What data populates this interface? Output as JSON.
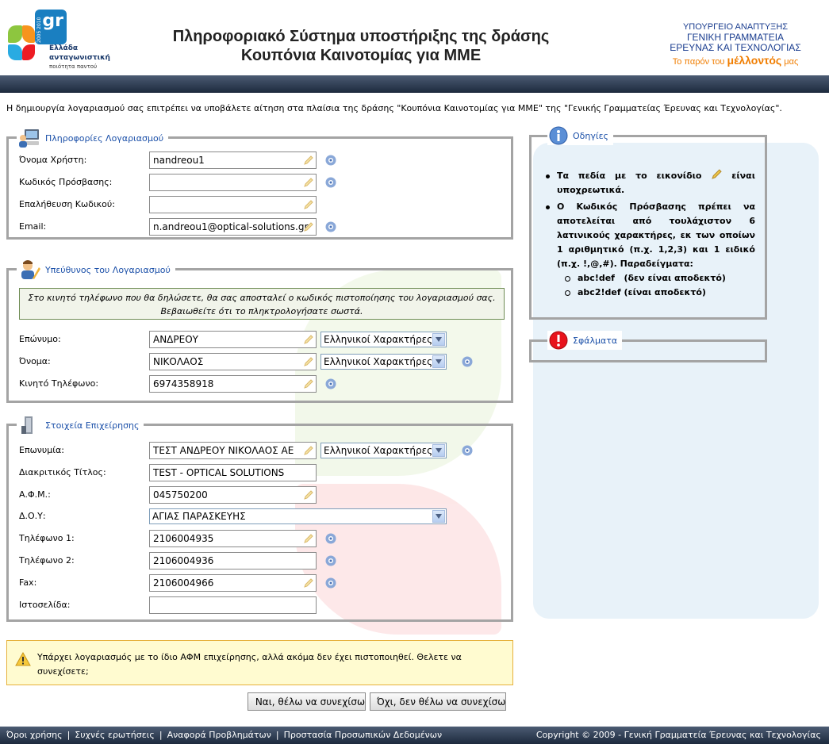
{
  "header": {
    "logo": {
      "gr": "gr",
      "years": "2005 2010",
      "line1": "Ελλάδα",
      "line2": "ανταγωνιστική",
      "line3": "ποιότητα παντού"
    },
    "title_line1": "Πληροφοριακό Σύστημα υποστήριξης της δράσης",
    "title_line2": "Κουπόνια Καινοτομίας για ΜΜΕ",
    "ministry_line1": "ΥΠΟΥΡΓΕΙΟ ΑΝΑΠΤΥΞΗΣ",
    "ministry_line2": "ΓΕΝΙΚΗ ΓΡΑΜΜΑΤΕΙΑ",
    "ministry_line3": "ΕΡΕΥΝΑΣ ΚΑΙ ΤΕΧΝΟΛΟΓΙΑΣ",
    "slogan_pre": "Το παρόν του",
    "slogan_bold": "μέλλοντός",
    "slogan_post": "μας"
  },
  "intro": "Η δημιουργία λογαριασμού σας επιτρέπει να υποβάλετε αίτηση στα πλαίσια της δράσης \"Κουπόνια Καινοτομίας για ΜΜΕ\" της \"Γενικής Γραμματείας Έρευνας και Τεχνολογίας\".",
  "account": {
    "legend": "Πληροφορίες Λογαριασμού",
    "username_label": "Όνομα Χρήστη:",
    "username_value": "nandreou1",
    "password_label": "Κωδικός Πρόσβασης:",
    "password_value": "",
    "confirm_label": "Επαλήθευση Κωδικού:",
    "confirm_value": "",
    "email_label": "Email:",
    "email_value": "n.andreou1@optical-solutions.gr"
  },
  "responsible": {
    "legend": "Υπεύθυνος του Λογαριασμού",
    "note_line1": "Στο κινητό τηλέφωνο που θα δηλώσετε, θα σας αποσταλεί ο κωδικός πιστοποίησης του λογαριασμού σας.",
    "note_line2": "Βεβαιωθείτε ότι το πληκτρολογήσατε σωστά.",
    "surname_label": "Επώνυμο:",
    "surname_value": "ΑΝΔΡΕΟΥ",
    "surname_charset": "Ελληνικοί Χαρακτήρες",
    "name_label": "Όνομα:",
    "name_value": "ΝΙΚΟΛΑΟΣ",
    "name_charset": "Ελληνικοί Χαρακτήρες",
    "mobile_label": "Κινητό Τηλέφωνο:",
    "mobile_value": "6974358918"
  },
  "company": {
    "legend": "Στοιχεία Επιχείρησης",
    "name_label": "Επωνυμία:",
    "name_value": "ΤΕΣΤ ΑΝΔΡΕΟΥ ΝΙΚΟΛΑΟΣ ΑΕ",
    "name_charset": "Ελληνικοί Χαρακτήρες",
    "title_label": "Διακριτικός Τίτλος:",
    "title_value": "TEST - OPTICAL SOLUTIONS",
    "afm_label": "Α.Φ.Μ.:",
    "afm_value": "045750200",
    "doy_label": "Δ.Ο.Υ:",
    "doy_value": "ΑΓΙΑΣ ΠΑΡΑΣΚΕΥΗΣ",
    "phone1_label": "Τηλέφωνο 1:",
    "phone1_value": "2106004935",
    "phone2_label": "Τηλέφωνο 2:",
    "phone2_value": "2106004936",
    "fax_label": "Fax:",
    "fax_value": "2106004966",
    "website_label": "Ιστοσελίδα:",
    "website_value": ""
  },
  "instructions": {
    "legend": "Οδηγίες",
    "item1_pre": "Τα πεδία με το εικονίδιο",
    "item1_post": "είναι υποχρεωτικά.",
    "item2": "Ο Κωδικός Πρόσβασης πρέπει να αποτελείται από τουλάχιστον 6 λατινικούς χαρακτήρες, εκ των οποίων 1 αριθμητικό (π.χ. 1,2,3) και 1 ειδικό (π.χ. !,@,#). Παραδείγματα:",
    "example1": "abc!def   (δεν είναι αποδεκτό)",
    "example2": "abc2!def (είναι αποδεκτό)"
  },
  "errors": {
    "legend": "Σφάλματα"
  },
  "warning": "Υπάρχει λογαριασμός με το ίδιο ΑΦΜ επιχείρησης, αλλά ακόμα δεν έχει πιστοποιηθεί. Θελετε να συνεχίσετε;",
  "buttons": {
    "yes": "Ναι, θέλω να συνεχίσω",
    "no": "Όχι, δεν θέλω να συνεχίσω"
  },
  "footer": {
    "terms": "Όροι χρήσης",
    "faq": "Συχνές ερωτήσεις",
    "report": "Αναφορά Προβλημάτων",
    "privacy": "Προστασία Προσωπικών Δεδομένων",
    "copyright": "Copyright © 2009 - Γενική Γραμματεία Έρευνας και Τεχνολογίας"
  },
  "colors": {
    "accent": "#1a4fa8",
    "bar": "#2c3a50",
    "warning_bg": "#fffbd0",
    "border": "#a4a4a4"
  }
}
